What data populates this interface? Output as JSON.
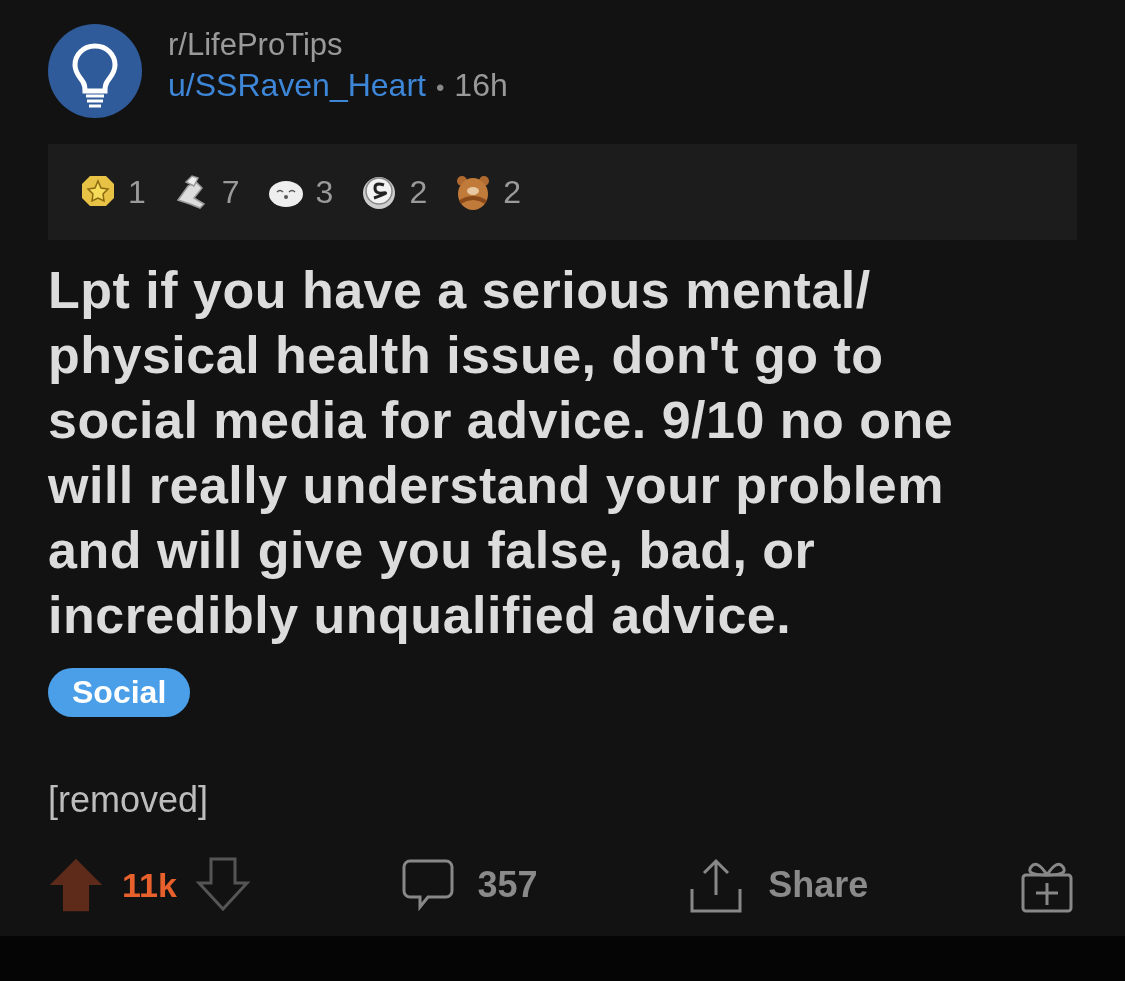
{
  "post": {
    "subreddit": "r/LifeProTips",
    "author": "u/SSRaven_Heart",
    "separator": "•",
    "age": "16h",
    "awards": [
      {
        "kind": "star",
        "count": "1"
      },
      {
        "kind": "handshake",
        "count": "7"
      },
      {
        "kind": "seal",
        "count": "3"
      },
      {
        "kind": "coin",
        "count": "2"
      },
      {
        "kind": "bear",
        "count": "2"
      }
    ],
    "title": "Lpt if you have a serious mental/ physical health issue, don't go to social media for advice. 9/10 no one will really understand your problem and will give you false, bad, or incredibly unqualified advice.",
    "flair": {
      "label": "Social",
      "color": "#4a9fe8"
    },
    "body": "[removed]",
    "vote": {
      "upvoted": true,
      "score": "11k"
    },
    "comments": "357",
    "share": "Share"
  }
}
